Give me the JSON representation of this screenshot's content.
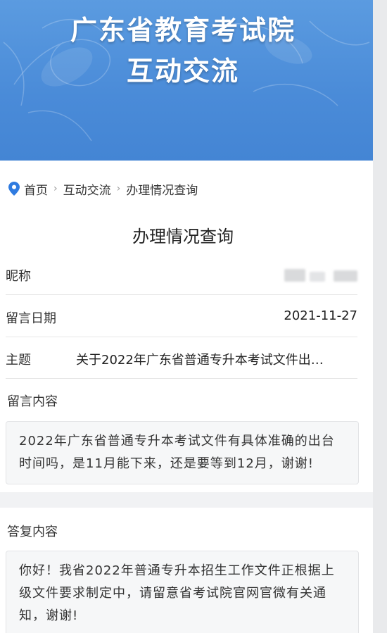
{
  "banner": {
    "title_line1": "广东省教育考试院",
    "title_line2": "互动交流"
  },
  "breadcrumb": {
    "icon": "location-pin-icon",
    "items": [
      "首页",
      "互动交流",
      "办理情况查询"
    ],
    "separator": "›"
  },
  "page_title": "办理情况查询",
  "fields": {
    "nickname_label": "昵称",
    "nickname_value": "",
    "date_label": "留言日期",
    "date_value": "2021-11-27",
    "subject_label": "主题",
    "subject_value": "关于2022年广东省普通专升本考试文件出…",
    "message_label": "留言内容",
    "message_value": "2022年广东省普通专升本考试文件有具体准确的出台时间吗，是11月能下来，还是要等到12月，谢谢!"
  },
  "reply": {
    "label": "答复内容",
    "value": "你好！我省2022年普通专升本招生工作文件正根据上级文件要求制定中，请留意省考试院官网官微有关通知，谢谢!"
  },
  "colors": {
    "banner": "#4a8bd8",
    "pin": "#2f7be0",
    "box_bg": "#f6f7f8"
  }
}
